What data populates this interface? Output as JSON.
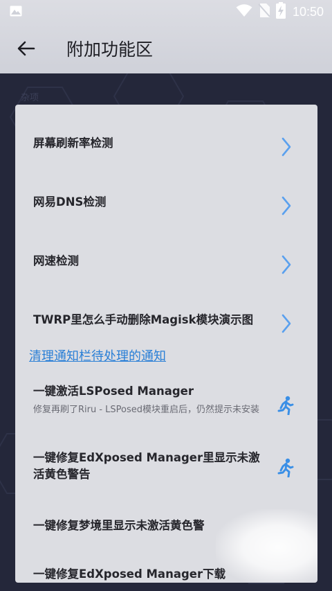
{
  "status_bar": {
    "time": "10:50",
    "icons": [
      "image-icon",
      "wifi-icon",
      "no-sim-icon",
      "battery-charging-icon"
    ]
  },
  "app_bar": {
    "title": "附加功能区",
    "back_icon": "arrow-left-icon"
  },
  "section": {
    "label": "杂项"
  },
  "menu_items": [
    {
      "title": "屏幕刷新率检测",
      "icon": "chevron-right-icon"
    },
    {
      "title": "网易DNS检测",
      "icon": "chevron-right-icon"
    },
    {
      "title": "网速检测",
      "icon": "chevron-right-icon"
    },
    {
      "title": "TWRP里怎么手动删除Magisk模块演示图",
      "icon": "chevron-right-icon"
    }
  ],
  "link": {
    "text": "清理通知栏待处理的通知"
  },
  "actions": [
    {
      "title": "一键激活LSPosed Manager",
      "subtitle": "修复再刷了Riru - LSPosed模块重启后，仍然提示未安装",
      "icon": "run-icon"
    },
    {
      "title": "一键修复EdXposed Manager里显示未激活黄色警告",
      "subtitle": "",
      "icon": "run-icon"
    },
    {
      "title": "一键修复梦境里显示未激活黄色警",
      "subtitle": "",
      "icon": ""
    },
    {
      "title": "一键修复EdXposed Manager下载",
      "subtitle": "",
      "icon": ""
    }
  ],
  "colors": {
    "accent": "#2a7fd6",
    "chevron": "#5aa0ee",
    "run_icon": "#3a8fe6",
    "background": "#24273a",
    "card": "#dcdde2"
  }
}
